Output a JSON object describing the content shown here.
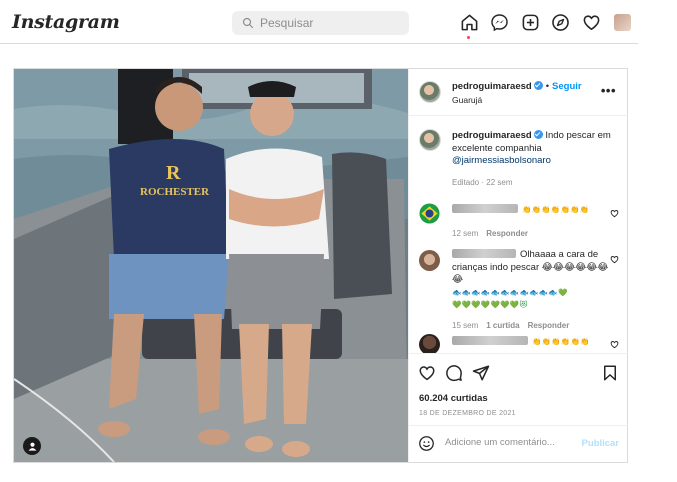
{
  "app": {
    "logo": "Instagram",
    "search_placeholder": "Pesquisar",
    "nav_icons": [
      "home-icon",
      "messenger-icon",
      "new-post-icon",
      "explore-icon",
      "activity-heart-icon",
      "profile-avatar"
    ]
  },
  "post": {
    "username": "pedroguimaraesd",
    "verified": true,
    "follow_label": "Seguir",
    "location": "Guarujá",
    "more_label": "•••",
    "caption": {
      "username": "pedroguimaraesd",
      "text": "Indo pescar em excelente companhia",
      "mention": "@jairmessiasbolsonaro",
      "edited": "Editado · 22 sem"
    },
    "comments": [
      {
        "avatar": "brazil-flag",
        "text": "👏👏👏👏👏👏👏",
        "time": "12 sem",
        "reply": "Responder"
      },
      {
        "avatar": "user-photo",
        "text_line1": "Olhaaaa a cara de crianças indo pescar 😂😂😂😂😂😂😂",
        "text_line2": "🐟🐟🐟🐟🐟🐟🐟🐟🐟🐟🐟💚",
        "text_line3": "💚💚💚💚💚💚💚😻",
        "time": "15 sem",
        "likes": "1 curtida",
        "reply": "Responder"
      },
      {
        "avatar": "user-photo-2",
        "text": "👏👏👏👏👏👏"
      }
    ],
    "likes_count": "60.204 curtidas",
    "date": "18 DE DEZEMBRO DE 2021",
    "add_comment_placeholder": "Adicione um comentário...",
    "publish_label": "Publicar"
  },
  "colors": {
    "accent": "#0095f6",
    "verified": "#3897f0",
    "border": "#dbdbdb",
    "muted": "#8e8e8e",
    "notification_dot": "#ed4956"
  }
}
